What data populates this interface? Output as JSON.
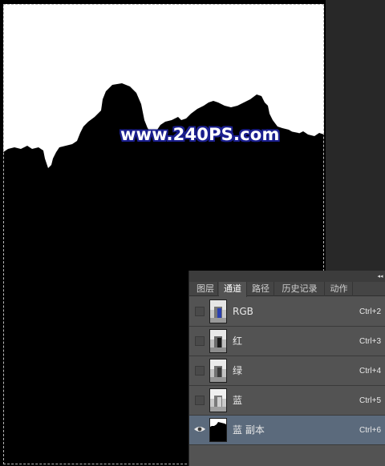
{
  "canvas": {
    "watermark": "www.240PS.com"
  },
  "panel": {
    "tabs": [
      {
        "label": "图层",
        "active": false
      },
      {
        "label": "通道",
        "active": true
      },
      {
        "label": "路径",
        "active": false
      },
      {
        "label": "历史记录",
        "active": false
      },
      {
        "label": "动作",
        "active": false
      }
    ],
    "channels": [
      {
        "name": "RGB",
        "shortcut": "Ctrl+2",
        "visible": false,
        "selected": false,
        "thumb": "color"
      },
      {
        "name": "红",
        "shortcut": "Ctrl+3",
        "visible": false,
        "selected": false,
        "thumb": "gray"
      },
      {
        "name": "绿",
        "shortcut": "Ctrl+4",
        "visible": false,
        "selected": false,
        "thumb": "gray"
      },
      {
        "name": "蓝",
        "shortcut": "Ctrl+5",
        "visible": false,
        "selected": false,
        "thumb": "gray"
      },
      {
        "name": "蓝 副本",
        "shortcut": "Ctrl+6",
        "visible": true,
        "selected": true,
        "thumb": "mask"
      }
    ]
  },
  "colors": {
    "panel_bg": "#535353",
    "selected_row": "#5b6a7c",
    "watermark_outline": "#1b1f8f"
  }
}
